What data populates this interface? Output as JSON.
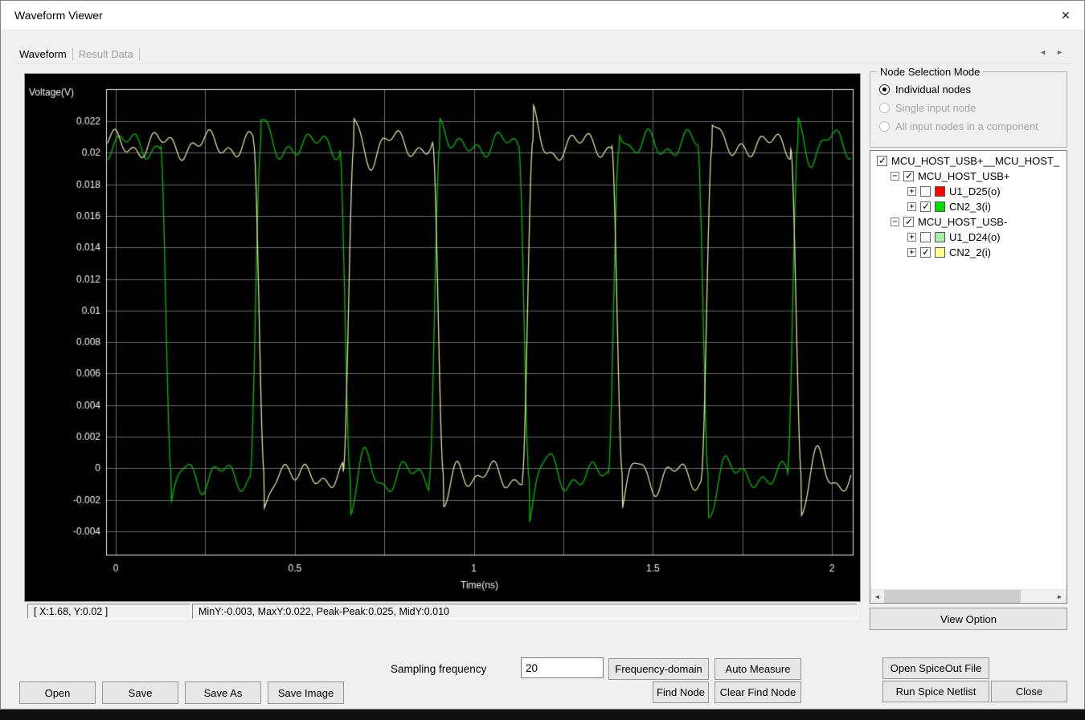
{
  "window": {
    "title": "Waveform Viewer"
  },
  "icons": {
    "close": "✕",
    "tab_prev": "◄",
    "tab_next": "►",
    "scroll_left": "◄",
    "scroll_right": "►",
    "tree_collapse": "−",
    "tree_expand": "+"
  },
  "tabs": {
    "items": [
      {
        "label": "Waveform",
        "active": true
      },
      {
        "label": "Result Data",
        "active": false
      }
    ]
  },
  "chart_data": {
    "type": "line",
    "title": "",
    "xlabel": "Time(ns)",
    "ylabel": "Voltage(V)",
    "xlim": [
      -0.027,
      2.058
    ],
    "ylim": [
      -0.00548,
      0.02404
    ],
    "xticks": [
      0,
      0.5,
      1,
      1.5,
      2
    ],
    "xtick_labels": [
      "0",
      "0.5",
      "1",
      "1.5",
      "2"
    ],
    "x_grid_step": 0.25,
    "x_grid_max": 2.0,
    "yticks": [
      0.022,
      0.02,
      0.018,
      0.016,
      0.014,
      0.012,
      0.01,
      0.008,
      0.006,
      0.004,
      0.002,
      0,
      -0.002,
      -0.004
    ],
    "ytick_labels": [
      "0.022",
      "0.02",
      "0.018",
      "0.016",
      "0.014",
      "0.012",
      "0.01",
      "0.008",
      "0.006",
      "0.004",
      "0.002",
      "0",
      "-0.002",
      "-0.004"
    ],
    "background": "#000000",
    "grid_color": "#6b6b6b",
    "axis_color": "#f2f2f2",
    "grid": true,
    "legend": "none",
    "series": [
      {
        "name": "CN2_3(i)",
        "color": "#00bf00",
        "high": 0.0205,
        "low": -0.0005,
        "falls": [
          0.125,
          0.625,
          1.125,
          1.625
        ],
        "rises": [
          0.375,
          0.875,
          1.375,
          1.875
        ]
      },
      {
        "name": "CN2_2(i)",
        "color": "#dede9f",
        "high": 0.0205,
        "low": -0.0005,
        "falls": [
          0.385,
          0.885,
          1.385,
          1.885
        ],
        "rises": [
          0.635,
          1.135,
          1.635
        ]
      }
    ],
    "ring": {
      "ramp": 0.03,
      "rise_overshoot": 0.0016,
      "fall_undershoot": 0.0024,
      "period": 0.1,
      "decay": 0.05,
      "ripple_amp": 0.0006
    }
  },
  "status_bar": {
    "cursor": "[ X:1.68, Y:0.02 ]",
    "stats": "MinY:-0.003, MaxY:0.022, Peak-Peak:0.025, MidY:0.010"
  },
  "node_selection": {
    "title": "Node Selection Mode",
    "options": [
      {
        "label": "Individual nodes",
        "selected": true,
        "enabled": true
      },
      {
        "label": "Single input node",
        "selected": false,
        "enabled": false
      },
      {
        "label": "All input nodes in a component",
        "selected": false,
        "enabled": false
      }
    ]
  },
  "tree": {
    "items": [
      {
        "level": 0,
        "expander": null,
        "checked": true,
        "swatch": null,
        "label": "MCU_HOST_USB+__MCU_HOST_"
      },
      {
        "level": 1,
        "expander": "minus",
        "checked": true,
        "swatch": null,
        "label": "MCU_HOST_USB+"
      },
      {
        "level": 2,
        "expander": "plus",
        "checked": false,
        "swatch": "#ff0000",
        "label": "U1_D25(o)"
      },
      {
        "level": 2,
        "expander": "plus",
        "checked": true,
        "swatch": "#00dd00",
        "label": "CN2_3(i)"
      },
      {
        "level": 1,
        "expander": "minus",
        "checked": true,
        "swatch": null,
        "label": "MCU_HOST_USB-"
      },
      {
        "level": 2,
        "expander": "plus",
        "checked": false,
        "swatch": "#a8f0a8",
        "label": "U1_D24(o)"
      },
      {
        "level": 2,
        "expander": "plus",
        "checked": true,
        "swatch": "#ffff8c",
        "label": "CN2_2(i)"
      }
    ]
  },
  "sampling": {
    "label": "Sampling frequency",
    "value": "20"
  },
  "buttons": {
    "view_option": "View Option",
    "frequency_domain": "Frequency-domain",
    "auto_measure": "Auto Measure",
    "find_node": "Find Node",
    "clear_find_node": "Clear Find Node",
    "open_spiceout": "Open SpiceOut File",
    "run_spice": "Run Spice Netlist",
    "close": "Close",
    "open": "Open",
    "save": "Save",
    "save_as": "Save As",
    "save_image": "Save Image"
  }
}
